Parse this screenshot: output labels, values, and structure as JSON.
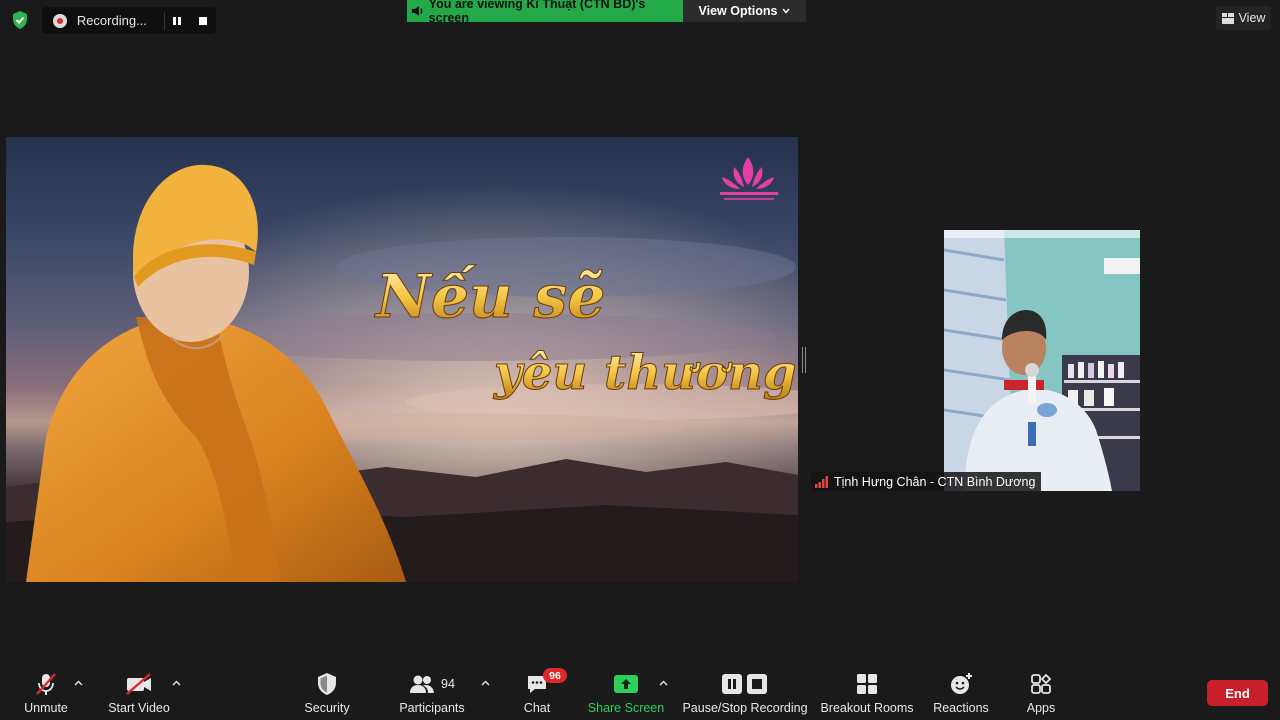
{
  "recording": {
    "label": "Recording..."
  },
  "banner": {
    "viewing": "You are viewing Kĩ Thuật (CTN BD)'s screen",
    "view_options": "View Options"
  },
  "view_button": {
    "label": "View"
  },
  "participant": {
    "name": "Tịnh Hưng Chân - CTN Bình Dương"
  },
  "shared_screen": {
    "title_line1": "Nếu sẽ",
    "title_line2": "yêu thương"
  },
  "toolbar": {
    "unmute": "Unmute",
    "start_video": "Start Video",
    "security": "Security",
    "participants": "Participants",
    "participants_count": "94",
    "chat": "Chat",
    "chat_badge": "96",
    "share_screen": "Share Screen",
    "pause_stop_recording": "Pause/Stop Recording",
    "breakout_rooms": "Breakout Rooms",
    "reactions": "Reactions",
    "apps": "Apps",
    "end": "End"
  },
  "colors": {
    "share_green": "#23a948",
    "end_red": "#c8202a",
    "badge_red": "#e02828",
    "accent_green": "#2fd05a"
  }
}
